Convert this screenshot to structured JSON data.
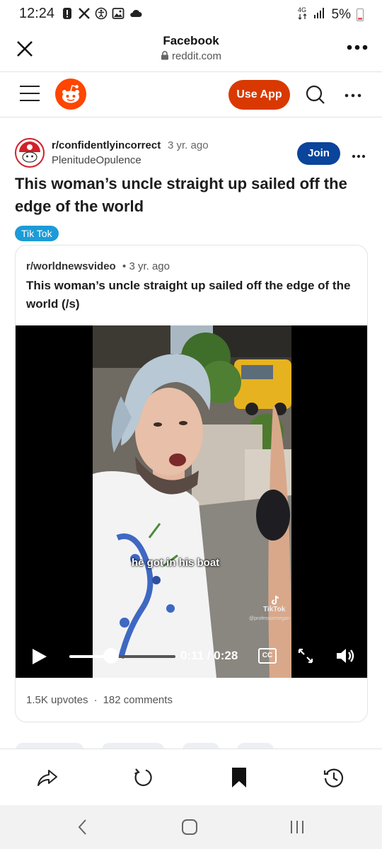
{
  "status_bar": {
    "time": "12:24",
    "battery_percent": "5%",
    "icons": [
      "alert-icon",
      "x-logo-icon",
      "accessibility-icon",
      "gallery-icon",
      "cloud-icon"
    ]
  },
  "browser": {
    "title": "Facebook",
    "url": "reddit.com"
  },
  "reddit_header": {
    "use_app_label": "Use App",
    "brand_color": "#d93900"
  },
  "post": {
    "subreddit": "r/confidentlyincorrect",
    "time": "3 yr. ago",
    "author": "PlenitudeOpulence",
    "join_label": "Join",
    "title": "This woman’s uncle straight up sailed off the edge of the world",
    "flair": "Tik Tok",
    "join_color": "#0a449b",
    "flair_color": "#1d9bd6"
  },
  "crosspost": {
    "subreddit": "r/worldnewsvideo",
    "separator": "•",
    "time": "3 yr. ago",
    "title": "This woman’s uncle straight up sailed off the edge of the world (/s)",
    "video": {
      "caption": "he got in his boat",
      "watermark": "TikTok",
      "handle": "@professormegan",
      "timecode": "0:11 / 0:28",
      "progress_fraction": 0.39,
      "cc_label": "CC"
    },
    "upvotes": "1.5K upvotes",
    "stats_separator": "·",
    "comments": "182 comments"
  }
}
